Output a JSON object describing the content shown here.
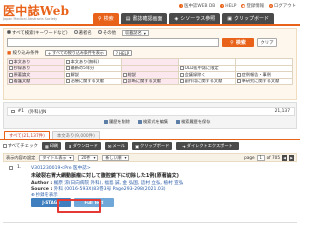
{
  "header": {
    "logo": "医中誌Web",
    "logo_sub": "Japan Medical Abstracts Society",
    "links": [
      "医中誌WEB DB",
      "HELP",
      "登録情報",
      "ログアウト"
    ]
  },
  "tabs": [
    {
      "label": "検索",
      "active": true
    },
    {
      "label": "書誌確認画面",
      "active": false
    },
    {
      "label": "シソーラス参照",
      "active": false
    },
    {
      "label": "クリップボード",
      "active": false
    }
  ],
  "search": {
    "options": [
      "すべて検索(キーワードなど)",
      "著者名",
      "その他"
    ],
    "range_select": "収載誌名",
    "input_value": "",
    "search_button": "検索",
    "clear_button": "クリア"
  },
  "filters": {
    "heading": "絞り込み条件",
    "buttons": [
      "すべての絞り込み条件を表示",
      "HELP"
    ],
    "items": [
      {
        "label": "本文あり",
        "pink": true
      },
      {
        "label": "本文あり(無料)",
        "pink": false
      },
      {
        "label": "",
        "pink": true
      },
      {
        "label": "",
        "pink": false
      },
      {
        "label": "",
        "pink": false
      },
      {
        "label": "抄録あり",
        "pink": true
      },
      {
        "label": "最新の5年分",
        "pink": false
      },
      {
        "label": "",
        "pink": true
      },
      {
        "label": "OLD医中誌に限定",
        "pink": false
      },
      {
        "label": "",
        "pink": false
      },
      {
        "label": "原著論文",
        "pink": true
      },
      {
        "label": "解説",
        "pink": false
      },
      {
        "label": "総説",
        "pink": true
      },
      {
        "label": "会議録除く",
        "pink": false
      },
      {
        "label": "症例報告・事例",
        "pink": false
      },
      {
        "label": "看護文献",
        "pink": true
      },
      {
        "label": "治療に関する文献",
        "pink": false
      },
      {
        "label": "診断に関する文献",
        "pink": true
      },
      {
        "label": "副作用に関する文献",
        "pink": false
      },
      {
        "label": "準研究に関する文献",
        "pink": false
      }
    ]
  },
  "history": {
    "number": "#1",
    "query": "(外科)/JN",
    "count": "21,137",
    "actions": [
      "履歴を削除",
      "検索式を編集",
      "検索履歴を保存"
    ]
  },
  "results": {
    "tabs": [
      {
        "label": "すべて(21,137件)",
        "state": "active"
      },
      {
        "label": "本文あり(9,000件)",
        "state": "dim"
      }
    ],
    "toolbar": {
      "select_all": "すべてチェック",
      "buttons": [
        "印刷",
        "ダウンロード",
        "メール",
        "クリップボード",
        "ダイレクトエクスポート"
      ]
    },
    "sort": {
      "label": "表示内容の設定",
      "display": "タイトル表示",
      "per_page": "20件",
      "order": "新しい順",
      "page_label": "page",
      "page": "1",
      "total_pages": "of 705"
    },
    "item": {
      "number": "1.",
      "id": "V301230019<Pre 医中誌>",
      "title": "未破裂右胃大網動脈瘤に対して腹腔鏡下に切除した1例(原著論文)",
      "author_label": "Author :",
      "authors": "梶原 涼(日向病院 外科), 福島 誠, 金 弘国, 這村 立弘, 植村 宣弘",
      "source_label": "Source :",
      "source": "外科 (0016-593X)83巻3号 Page293-298(2021.03)",
      "abstract_link": "抄録を表示",
      "links": [
        "J-STAGE",
        "Full Text"
      ]
    }
  },
  "colors": {
    "accent": "#e8621a",
    "dark": "#4a4a4a",
    "link": "#2a5ca8",
    "highlight": "#e53935"
  }
}
